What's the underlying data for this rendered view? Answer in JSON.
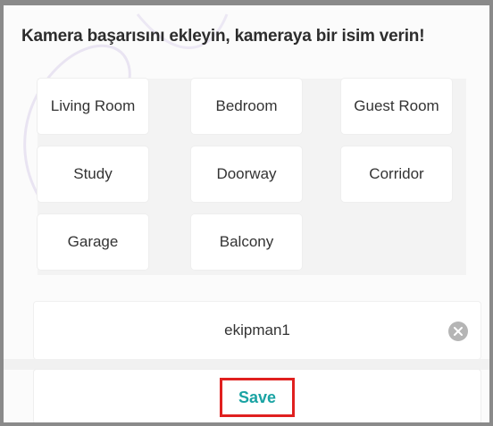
{
  "dialog": {
    "title": "Kamera başarısını ekleyin, kameraya bir isim verin!"
  },
  "room_options": [
    "Living Room",
    "Bedroom",
    "Guest Room",
    "Study",
    "Doorway",
    "Corridor",
    "Garage",
    "Balcony"
  ],
  "name_input": {
    "value": "ekipman1",
    "clear_icon": "clear-icon"
  },
  "actions": {
    "save_label": "Save",
    "save_color": "#1aa3a3",
    "highlight_color": "#e0201f"
  }
}
